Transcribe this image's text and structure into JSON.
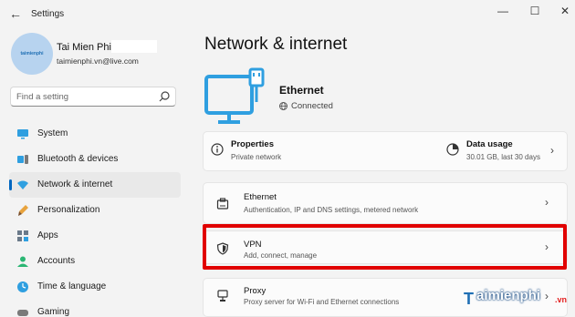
{
  "window": {
    "title": "Settings",
    "back_glyph": "←",
    "minimize_glyph": "—",
    "maximize_glyph": "☐",
    "close_glyph": "✕"
  },
  "profile": {
    "name": "Tai Mien Phi",
    "email": "taimienphi.vn@live.com",
    "avatar_text": "taimienphi"
  },
  "search": {
    "placeholder": "Find a setting",
    "icon": "search-icon"
  },
  "sidebar": {
    "items": [
      {
        "label": "System",
        "icon": "monitor-icon",
        "active": false
      },
      {
        "label": "Bluetooth & devices",
        "icon": "bluetooth-icon",
        "active": false
      },
      {
        "label": "Network & internet",
        "icon": "wifi-icon",
        "active": true
      },
      {
        "label": "Personalization",
        "icon": "brush-icon",
        "active": false
      },
      {
        "label": "Apps",
        "icon": "apps-icon",
        "active": false
      },
      {
        "label": "Accounts",
        "icon": "person-icon",
        "active": false
      },
      {
        "label": "Time & language",
        "icon": "globe-clock-icon",
        "active": false
      },
      {
        "label": "Gaming",
        "icon": "gamepad-icon",
        "active": false
      }
    ]
  },
  "main": {
    "title": "Network & internet",
    "connection": {
      "name": "Ethernet",
      "status": "Connected",
      "icon": "ethernet-monitor-icon"
    },
    "info": {
      "properties": {
        "label": "Properties",
        "desc": "Private network",
        "icon": "info-icon"
      },
      "data_usage": {
        "label": "Data usage",
        "desc": "30.01 GB, last 30 days",
        "icon": "data-usage-icon"
      }
    },
    "rows": [
      {
        "label": "Ethernet",
        "desc": "Authentication, IP and DNS settings, metered network",
        "icon": "ethernet-port-icon"
      },
      {
        "label": "VPN",
        "desc": "Add, connect, manage",
        "icon": "shield-icon"
      },
      {
        "label": "Proxy",
        "desc": "Proxy server for Wi-Fi and Ethernet connections",
        "icon": "proxy-icon"
      }
    ],
    "chevron": "›"
  },
  "watermark": {
    "mark": "T",
    "text": "aimienphi",
    "suffix": ".vn"
  },
  "colors": {
    "accent": "#0067c0",
    "highlight": "#e10000",
    "hero_icon": "#2f9fe0"
  }
}
